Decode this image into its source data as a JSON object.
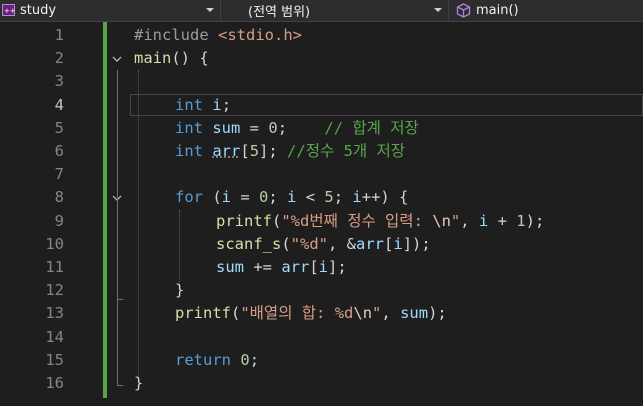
{
  "navbar": {
    "project": "study",
    "scope": "(전역 범위)",
    "member": "main()"
  },
  "editor": {
    "current_line": 4,
    "line_numbers": [
      "1",
      "2",
      "3",
      "4",
      "5",
      "6",
      "7",
      "8",
      "9",
      "10",
      "11",
      "12",
      "13",
      "14",
      "15",
      "16"
    ],
    "lines": {
      "l1": {
        "a": "#include ",
        "b": "<stdio.h>"
      },
      "l2": {
        "a": "main",
        "b": "() {"
      },
      "l4": {
        "a": "int",
        "b": " ",
        "c": "i",
        "d": ";"
      },
      "l5": {
        "a": "int",
        "b": " ",
        "c": "sum",
        "d": " = ",
        "e": "0",
        "f": ";    ",
        "g": "// 합계 저장"
      },
      "l6": {
        "a": "int",
        "b": " ",
        "c": "arr",
        "d": "[",
        "e": "5",
        "f": "]; ",
        "g": "//정수 5개 저장"
      },
      "l8": {
        "a": "for",
        "b": " (",
        "c": "i",
        "d": " = ",
        "e": "0",
        "f": "; ",
        "g": "i",
        "h": " < ",
        "i": "5",
        "j": "; ",
        "k": "i",
        "l": "++) {"
      },
      "l9": {
        "a": "printf",
        "b": "(",
        "c": "\"%d번째 정수 입력: ",
        "d": "\\n",
        "e": "\"",
        "f": ", ",
        "g": "i",
        "h": " + ",
        "i": "1",
        "j": ");"
      },
      "l10": {
        "a": "scanf_s",
        "b": "(",
        "c": "\"%d\"",
        "d": ", &",
        "e": "arr",
        "f": "[",
        "g": "i",
        "h": "]);"
      },
      "l11": {
        "a": "sum",
        "b": " += ",
        "c": "arr",
        "d": "[",
        "e": "i",
        "f": "];"
      },
      "l12": {
        "a": "}"
      },
      "l13": {
        "a": "printf",
        "b": "(",
        "c": "\"배열의 합: %d",
        "d": "\\n",
        "e": "\"",
        "f": ", ",
        "g": "sum",
        "h": ");"
      },
      "l15": {
        "a": "return",
        "b": " ",
        "c": "0",
        "d": ";"
      },
      "l16": {
        "a": "}"
      }
    }
  },
  "colors": {
    "background": "#1e1e1e",
    "keyword": "#569cd6",
    "string": "#d69d85",
    "function": "#dcdcaa",
    "variable": "#9cdcfe",
    "number": "#b5cea8",
    "comment": "#57a64a",
    "change_bar": "#57a64a"
  },
  "icons": {
    "project": "cpp-project-icon",
    "member": "cube-icon",
    "fold": "chevron-down-icon"
  }
}
